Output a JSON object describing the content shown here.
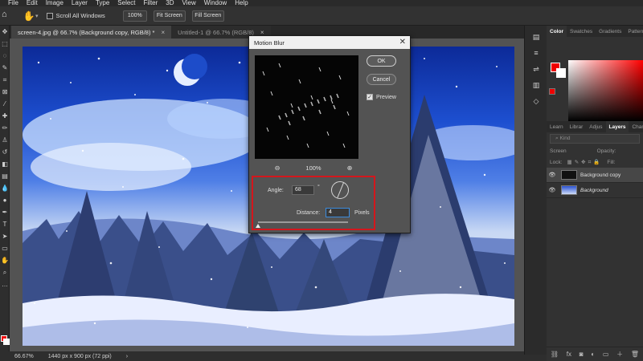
{
  "menu": {
    "items": [
      "File",
      "Edit",
      "Image",
      "Layer",
      "Type",
      "Select",
      "Filter",
      "3D",
      "View",
      "Window",
      "Help"
    ]
  },
  "options_bar": {
    "scroll_all_windows": "Scroll All Windows",
    "zoom_value": "100%",
    "fit_screen": "Fit Screen",
    "fill_screen": "Fill Screen"
  },
  "tabs": [
    {
      "label": "screen-4.jpg @ 66.7% (Background copy, RGB/8) *",
      "active": true
    },
    {
      "label": "Untitled-1 @ 66.7% (RGB/8)",
      "active": false
    }
  ],
  "status": {
    "zoom": "66.67%",
    "doc_info": "1440 px x 900 px (72 ppi)"
  },
  "panels": {
    "color_tabs": [
      "Color",
      "Swatches",
      "Gradients",
      "Patterns"
    ],
    "layers_tabs": [
      "Learn",
      "Librar",
      "Adjus",
      "Layers",
      "Chan"
    ],
    "kind_placeholder": "Kind",
    "blend_mode": "Screen",
    "opacity_label": "Opacity:",
    "lock_label": "Lock:",
    "fill_label": "Fill:",
    "layers": [
      {
        "name": "Background copy",
        "selected": true,
        "italic": false
      },
      {
        "name": "Background",
        "selected": false,
        "italic": true
      }
    ]
  },
  "dialog": {
    "title": "Motion Blur",
    "ok": "OK",
    "cancel": "Cancel",
    "preview_label": "Preview",
    "preview_checked": true,
    "preview_zoom": "100%",
    "angle_label": "Angle:",
    "angle_value": "68",
    "angle_unit": "°",
    "distance_label": "Distance:",
    "distance_value": "4",
    "distance_unit": "Pixels"
  },
  "colors": {
    "foreground": "#e00000",
    "background": "#ffffff",
    "highlight": "#d4161c"
  }
}
